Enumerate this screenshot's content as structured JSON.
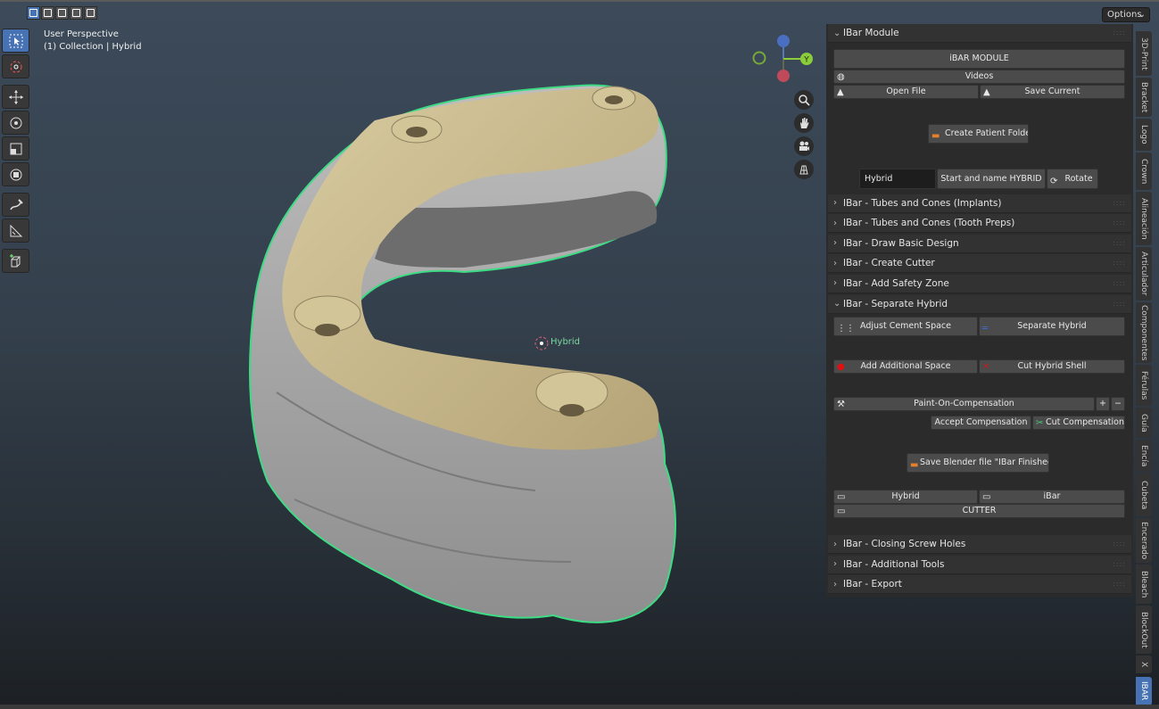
{
  "viewport": {
    "perspective": "User Perspective",
    "collection": "(1) Collection | Hybrid",
    "origin_label": "Hybrid"
  },
  "header": {
    "options_label": "Options"
  },
  "gizmo": {
    "y_axis": "Y"
  },
  "panel": {
    "module_title": "IBar Module",
    "module": {
      "title_button": "iBAR MODULE",
      "videos": "Videos",
      "open_file": "Open File",
      "save_current": "Save Current",
      "create_patient_folder": "Create Patient Folder",
      "name_value": "Hybrid",
      "start_name": "Start and name HYBRID",
      "rotate": "Rotate"
    },
    "sections_before": [
      "IBar - Tubes and Cones (Implants)",
      "IBar - Tubes and Cones (Tooth Preps)",
      "IBar - Draw Basic Design",
      "IBar - Create Cutter",
      "IBar - Add Safety Zone"
    ],
    "separate_title": "IBar - Separate Hybrid",
    "separate": {
      "adjust_cement": "Adjust Cement Space",
      "separate_hybrid": "Separate Hybrid",
      "add_space": "Add Additional Space",
      "cut_shell": "Cut Hybrid Shell",
      "paint_comp": "Paint-On-Compensation",
      "plus": "+",
      "minus": "−",
      "accept_comp": "Accept Compensation",
      "cut_comp": "Cut Compensation",
      "save_blender": "Save Blender file \"IBar Finished\"",
      "hybrid": "Hybrid",
      "ibar": "iBar",
      "cutter": "CUTTER"
    },
    "sections_after": [
      "IBar - Closing Screw Holes",
      "IBar - Additional Tools",
      "IBar - Export"
    ]
  },
  "tabs": [
    "3D-Print",
    "Bracket",
    "Logo",
    "Crown",
    "Alineación",
    "Articulador",
    "Componentes",
    "Férulas",
    "Guía",
    "Encía",
    "Cubeta",
    "Encerado",
    "Bleach",
    "BlockOut",
    "X",
    "IBAR"
  ],
  "colors": {
    "accent": "#4772b3",
    "selection_outline": "#3ddc84",
    "gold": "#c8b88c",
    "model_gray": "#a8a8a8"
  }
}
